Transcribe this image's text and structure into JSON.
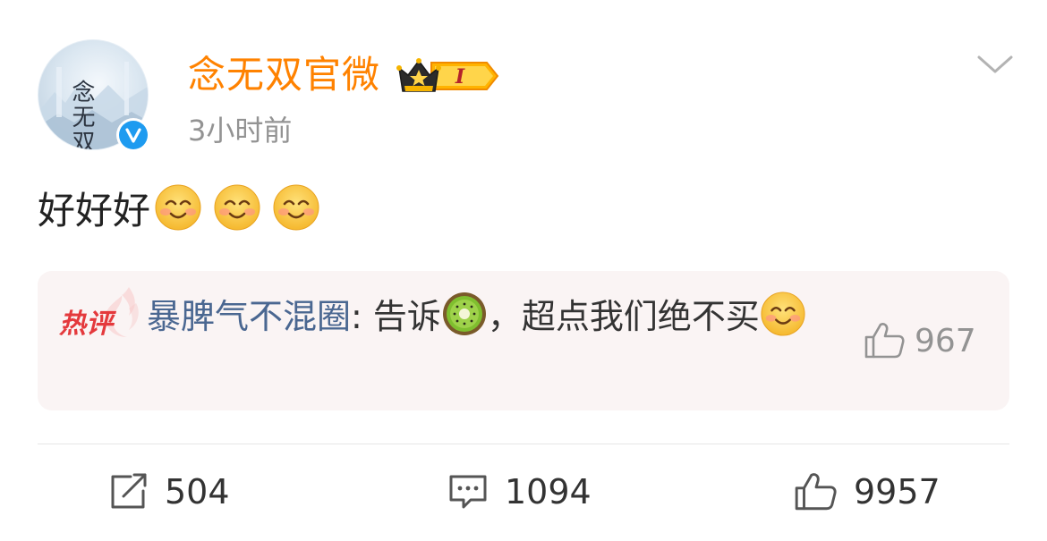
{
  "post": {
    "author": {
      "name": "念无双官微",
      "badge_level": "I",
      "avatar_text": "念无双"
    },
    "time": "3小时前",
    "text": "好好好",
    "text_emoji_count": 3
  },
  "hot_comment": {
    "label": "热评",
    "user": "暴脾气不混圈",
    "separator": ": ",
    "text_before": "告诉",
    "text_after": "，超点我们绝不买",
    "likes": "967"
  },
  "actions": {
    "reposts": "504",
    "comments": "1094",
    "likes": "9957"
  },
  "colors": {
    "author_name": "#ff8200",
    "meta_text": "#939393",
    "link_user": "#4a6791",
    "hot_label": "#e4393c",
    "comment_bg": "#faf4f4",
    "verified": "#1e9bf0"
  },
  "icons": {
    "more": "chevron-down-icon",
    "verified": "verified-v-icon",
    "crown": "crown-icon",
    "repost": "repost-icon",
    "comment": "comment-icon",
    "like": "thumbs-up-icon",
    "smile": "smiling-face-emoji",
    "kiwi": "kiwi-emoji"
  }
}
